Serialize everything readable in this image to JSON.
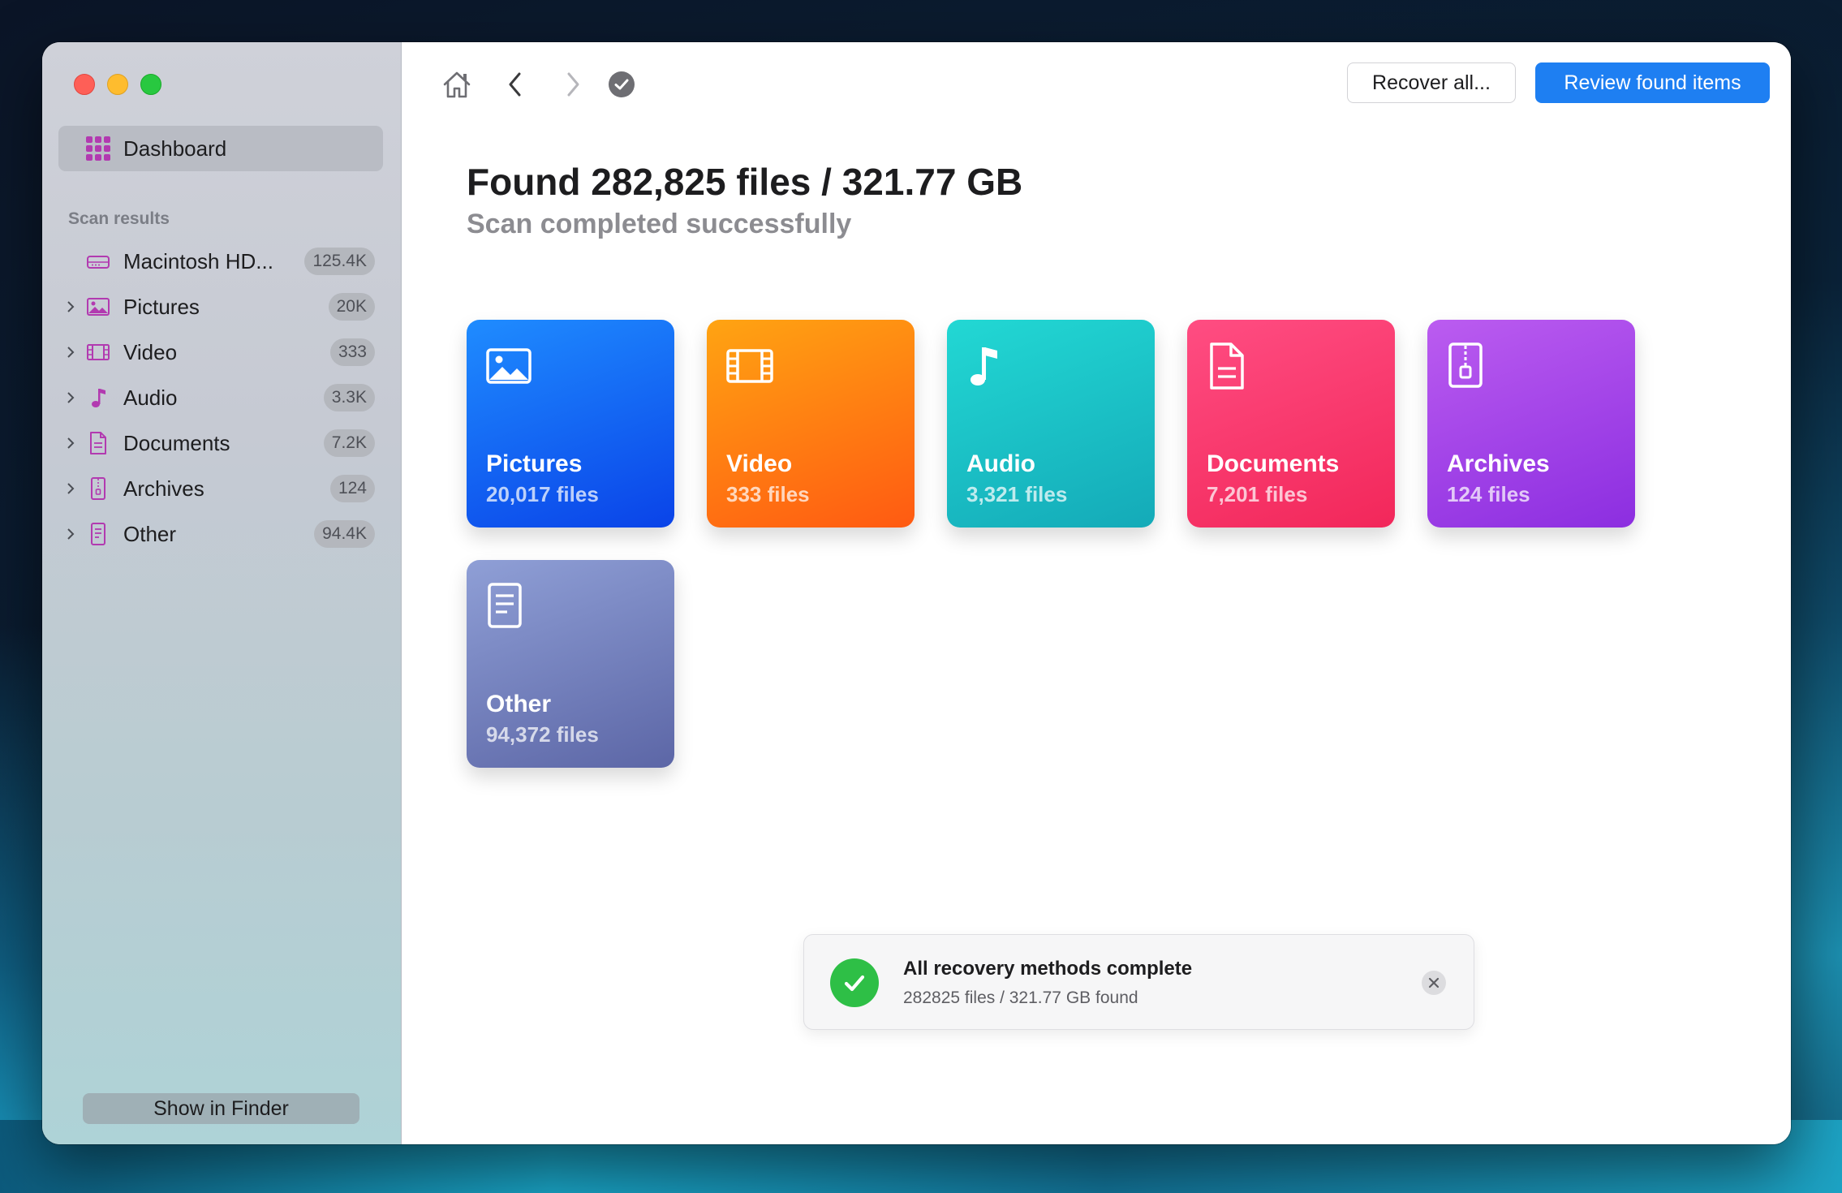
{
  "sidebar": {
    "dashboard_label": "Dashboard",
    "section_label": "Scan results",
    "items": [
      {
        "label": "Macintosh HD...",
        "count": "125.4K",
        "icon": "drive-icon",
        "expandable": false,
        "color": "#b23ab0"
      },
      {
        "label": "Pictures",
        "count": "20K",
        "icon": "picture-icon",
        "expandable": true,
        "color": "#b23ab0"
      },
      {
        "label": "Video",
        "count": "333",
        "icon": "film-icon",
        "expandable": true,
        "color": "#b23ab0"
      },
      {
        "label": "Audio",
        "count": "3.3K",
        "icon": "music-note-icon",
        "expandable": true,
        "color": "#b23ab0"
      },
      {
        "label": "Documents",
        "count": "7.2K",
        "icon": "document-icon",
        "expandable": true,
        "color": "#b23ab0"
      },
      {
        "label": "Archives",
        "count": "124",
        "icon": "archive-icon",
        "expandable": true,
        "color": "#b23ab0"
      },
      {
        "label": "Other",
        "count": "94.4K",
        "icon": "other-file-icon",
        "expandable": true,
        "color": "#b23ab0"
      }
    ],
    "finder_button": "Show in Finder"
  },
  "toolbar": {
    "icons": [
      "home-icon",
      "back-icon",
      "forward-icon",
      "check-circle-icon"
    ],
    "recover_all": "Recover all...",
    "review_found": "Review found items"
  },
  "main": {
    "headline": "Found 282,825 files / 321.77 GB",
    "subline": "Scan completed successfully"
  },
  "cards": [
    {
      "title": "Pictures",
      "sub": "20,017 files",
      "icon": "picture-icon",
      "from": "#1f8cff",
      "to": "#0a43e8"
    },
    {
      "title": "Video",
      "sub": "333 files",
      "icon": "film-icon",
      "from": "#ffa412",
      "to": "#ff5a12"
    },
    {
      "title": "Audio",
      "sub": "3,321 files",
      "icon": "music-note-icon",
      "from": "#22d8d4",
      "to": "#14aab8"
    },
    {
      "title": "Documents",
      "sub": "7,201 files",
      "icon": "document-icon",
      "from": "#ff4d82",
      "to": "#f2275a"
    },
    {
      "title": "Archives",
      "sub": "124 files",
      "icon": "archive-icon",
      "from": "#bb5cf0",
      "to": "#8c2ee0"
    },
    {
      "title": "Other",
      "sub": "94,372 files",
      "icon": "other-file-icon",
      "from": "#8f9fd6",
      "to": "#5c66a6"
    }
  ],
  "toast": {
    "title": "All recovery methods complete",
    "sub": "282825 files / 321.77 GB found",
    "icons": [
      "success-check-icon",
      "close-icon"
    ]
  },
  "colors": {
    "accent": "#1e7ff2",
    "success": "#2ebf46",
    "sidebar_icon": "#b23ab0"
  }
}
